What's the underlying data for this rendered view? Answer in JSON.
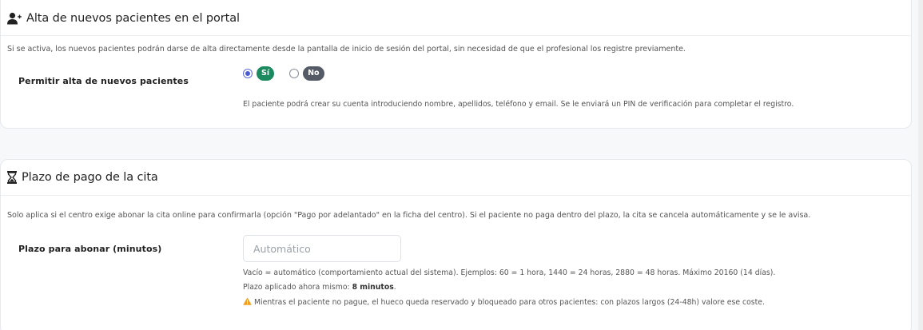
{
  "portal_signup": {
    "icon": "user-plus-icon",
    "title": "Alta de nuevos pacientes en el portal",
    "description": "Si se activa, los nuevos pacientes podrán darse de alta directamente desde la pantalla de inicio de sesión del portal, sin necesidad de que el profesional los registre previamente.",
    "field_label": "Permitir alta de nuevos pacientes",
    "options": [
      {
        "label": "Sí",
        "selected": true,
        "color": "#1b8a5e"
      },
      {
        "label": "No",
        "selected": false,
        "color": "#555b66"
      }
    ],
    "help": "El paciente podrá crear su cuenta introduciendo nombre, apellidos, teléfono y email. Se le enviará un PIN de verificación para completar el registro."
  },
  "payment_deadline": {
    "icon": "hourglass-icon",
    "title": "Plazo de pago de la cita",
    "description": "Solo aplica si el centro exige abonar la cita online para confirmarla (opción \"Pago por adelantado\" en la ficha del centro). Si el paciente no paga dentro del plazo, la cita se cancela automáticamente y se le avisa.",
    "field_label": "Plazo para abonar (minutos)",
    "input_value": "",
    "input_placeholder": "Automático",
    "help_line1": "Vacío = automático (comportamiento actual del sistema). Ejemplos: 60 = 1 hora, 1440 = 24 horas, 2880 = 48 horas. Máximo 20160 (14 días).",
    "applied_prefix": "Plazo aplicado ahora mismo: ",
    "applied_value": "8 minutos",
    "applied_suffix": ".",
    "warning_icon": "warning-icon",
    "warning_color": "#f0a020",
    "warning_text": "Mientras el paciente no pague, el hueco queda reservado y bloqueado para otros pacientes: con plazos largos (24-48h) valore ese coste."
  }
}
